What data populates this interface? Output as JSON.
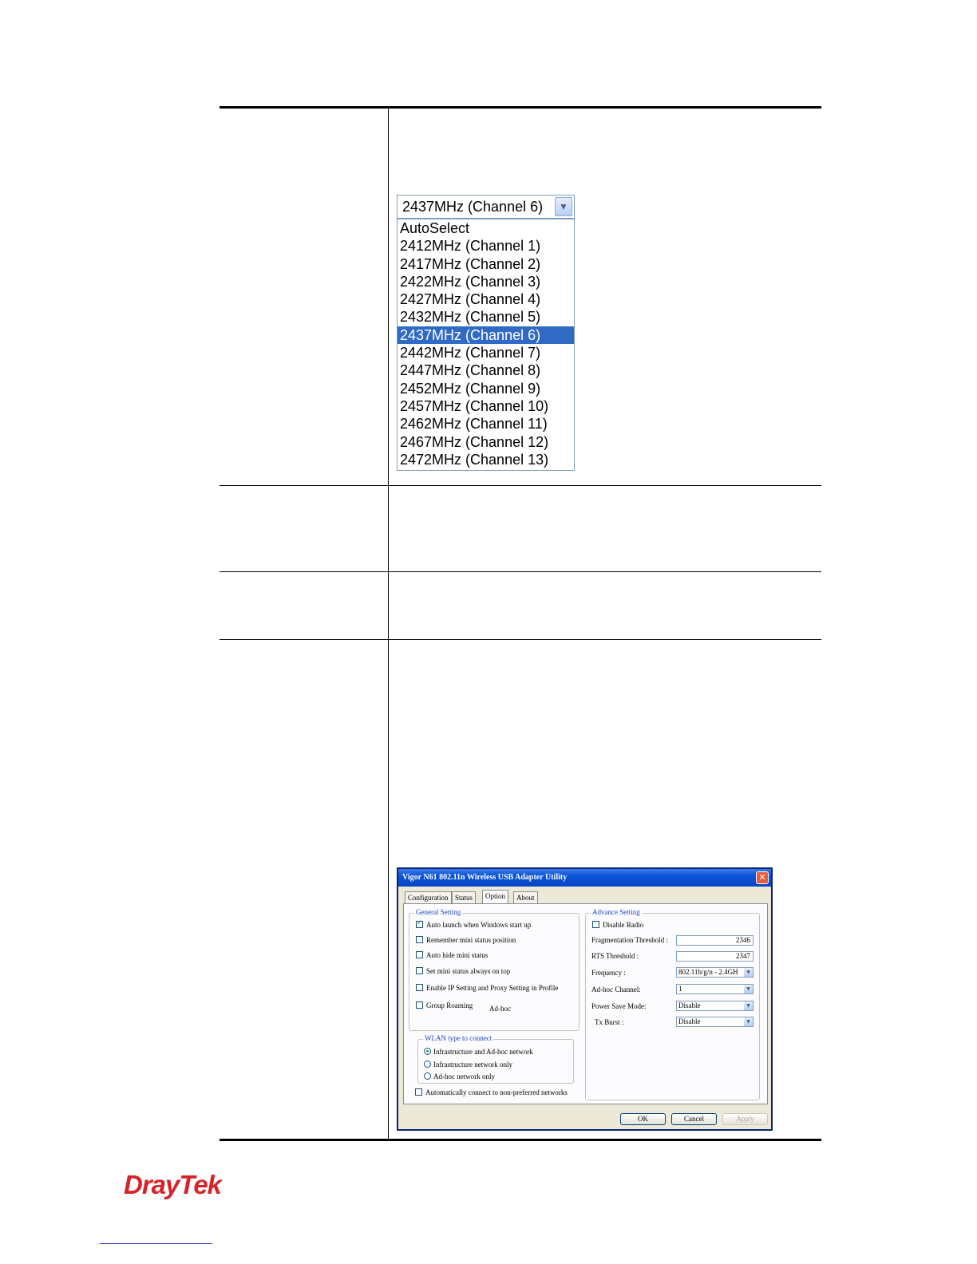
{
  "frequency_select": {
    "selected": "2437MHz (Channel 6)",
    "options": [
      "AutoSelect",
      "2412MHz (Channel 1)",
      "2417MHz (Channel 2)",
      "2422MHz (Channel 3)",
      "2427MHz (Channel 4)",
      "2432MHz (Channel 5)",
      "2437MHz (Channel 6)",
      "2442MHz (Channel 7)",
      "2447MHz (Channel 8)",
      "2452MHz (Channel 9)",
      "2457MHz (Channel 10)",
      "2462MHz (Channel 11)",
      "2467MHz (Channel 12)",
      "2472MHz (Channel 13)"
    ],
    "highlighted_index": 6
  },
  "dialog": {
    "title": "Vigor N61 802.11n Wireless USB Adapter Utility",
    "tabs": [
      "Configuration",
      "Status",
      "Option",
      "About"
    ],
    "active_tab": "Option",
    "general": {
      "label": "General Setting",
      "items": [
        {
          "label": "Auto launch when Windows start up",
          "checked": true
        },
        {
          "label": "Remember mini status position",
          "checked": false
        },
        {
          "label": "Auto hide mini status",
          "checked": false
        },
        {
          "label": "Set mini status always on top",
          "checked": false
        },
        {
          "label": "Enable IP Setting and Proxy Setting in Profile",
          "checked": false
        },
        {
          "label": "Group Roaming",
          "checked": false
        }
      ],
      "adhoc_label": "Ad-hoc"
    },
    "wlan": {
      "label": "WLAN type to connect",
      "options": [
        {
          "label": "Infrastructure and Ad-hoc network",
          "selected": true
        },
        {
          "label": "Infrastructure network only",
          "selected": false
        },
        {
          "label": "Ad-hoc network only",
          "selected": false
        }
      ]
    },
    "auto_connect": {
      "label": "Automatically connect to non-preferred networks",
      "checked": false
    },
    "advance": {
      "label": "Advance Setting",
      "disable_radio": {
        "label": "Disable Radio",
        "checked": false
      },
      "frag_label": "Fragmentation Threshold :",
      "frag_value": "2346",
      "rts_label": "RTS Threshold :",
      "rts_value": "2347",
      "freq_label": "Frequency :",
      "freq_value": "802.11b/g/n - 2.4GH",
      "adhoc_channel_label": "Ad-hoc Channel:",
      "adhoc_channel_value": "1",
      "power_label": "Power Save Mode:",
      "power_value": "Disable",
      "txburst_label": "Tx Burst :",
      "txburst_value": "Disable"
    },
    "buttons": {
      "ok": "OK",
      "cancel": "Cancel",
      "apply": "Apply"
    }
  },
  "footer": {
    "logo": "DrayTek"
  },
  "colors": {
    "highlight": "#316ac5",
    "title_bar": "#0a54d8",
    "logo": "#d6232a"
  }
}
